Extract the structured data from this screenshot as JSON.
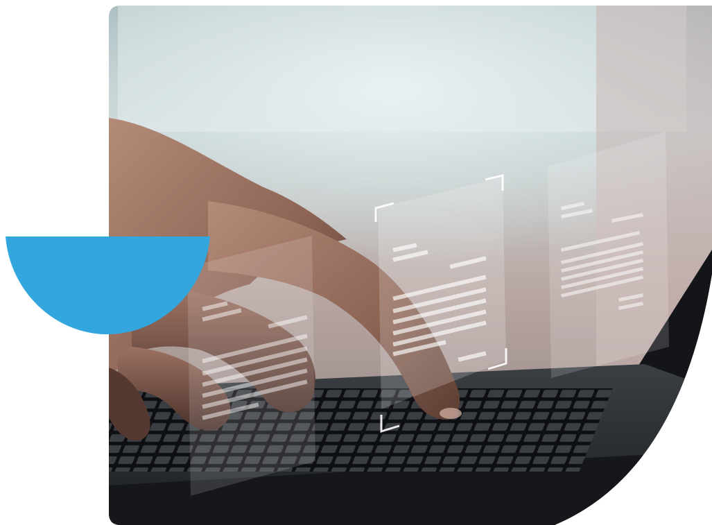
{
  "scene": {
    "photo_icon": "hand-typing-laptop-illustration",
    "accent_icon": "half-circle-shape",
    "document_icon": "floating-document-icon"
  },
  "colors": {
    "accent": "#33A6DE",
    "background": "#FFFFFF",
    "window_light": "#DCE7EA",
    "skin": "#A77C69",
    "laptop_body": "#2A2D31",
    "keyboard": "#101114",
    "overlay_panel": "#FFFFFF"
  }
}
